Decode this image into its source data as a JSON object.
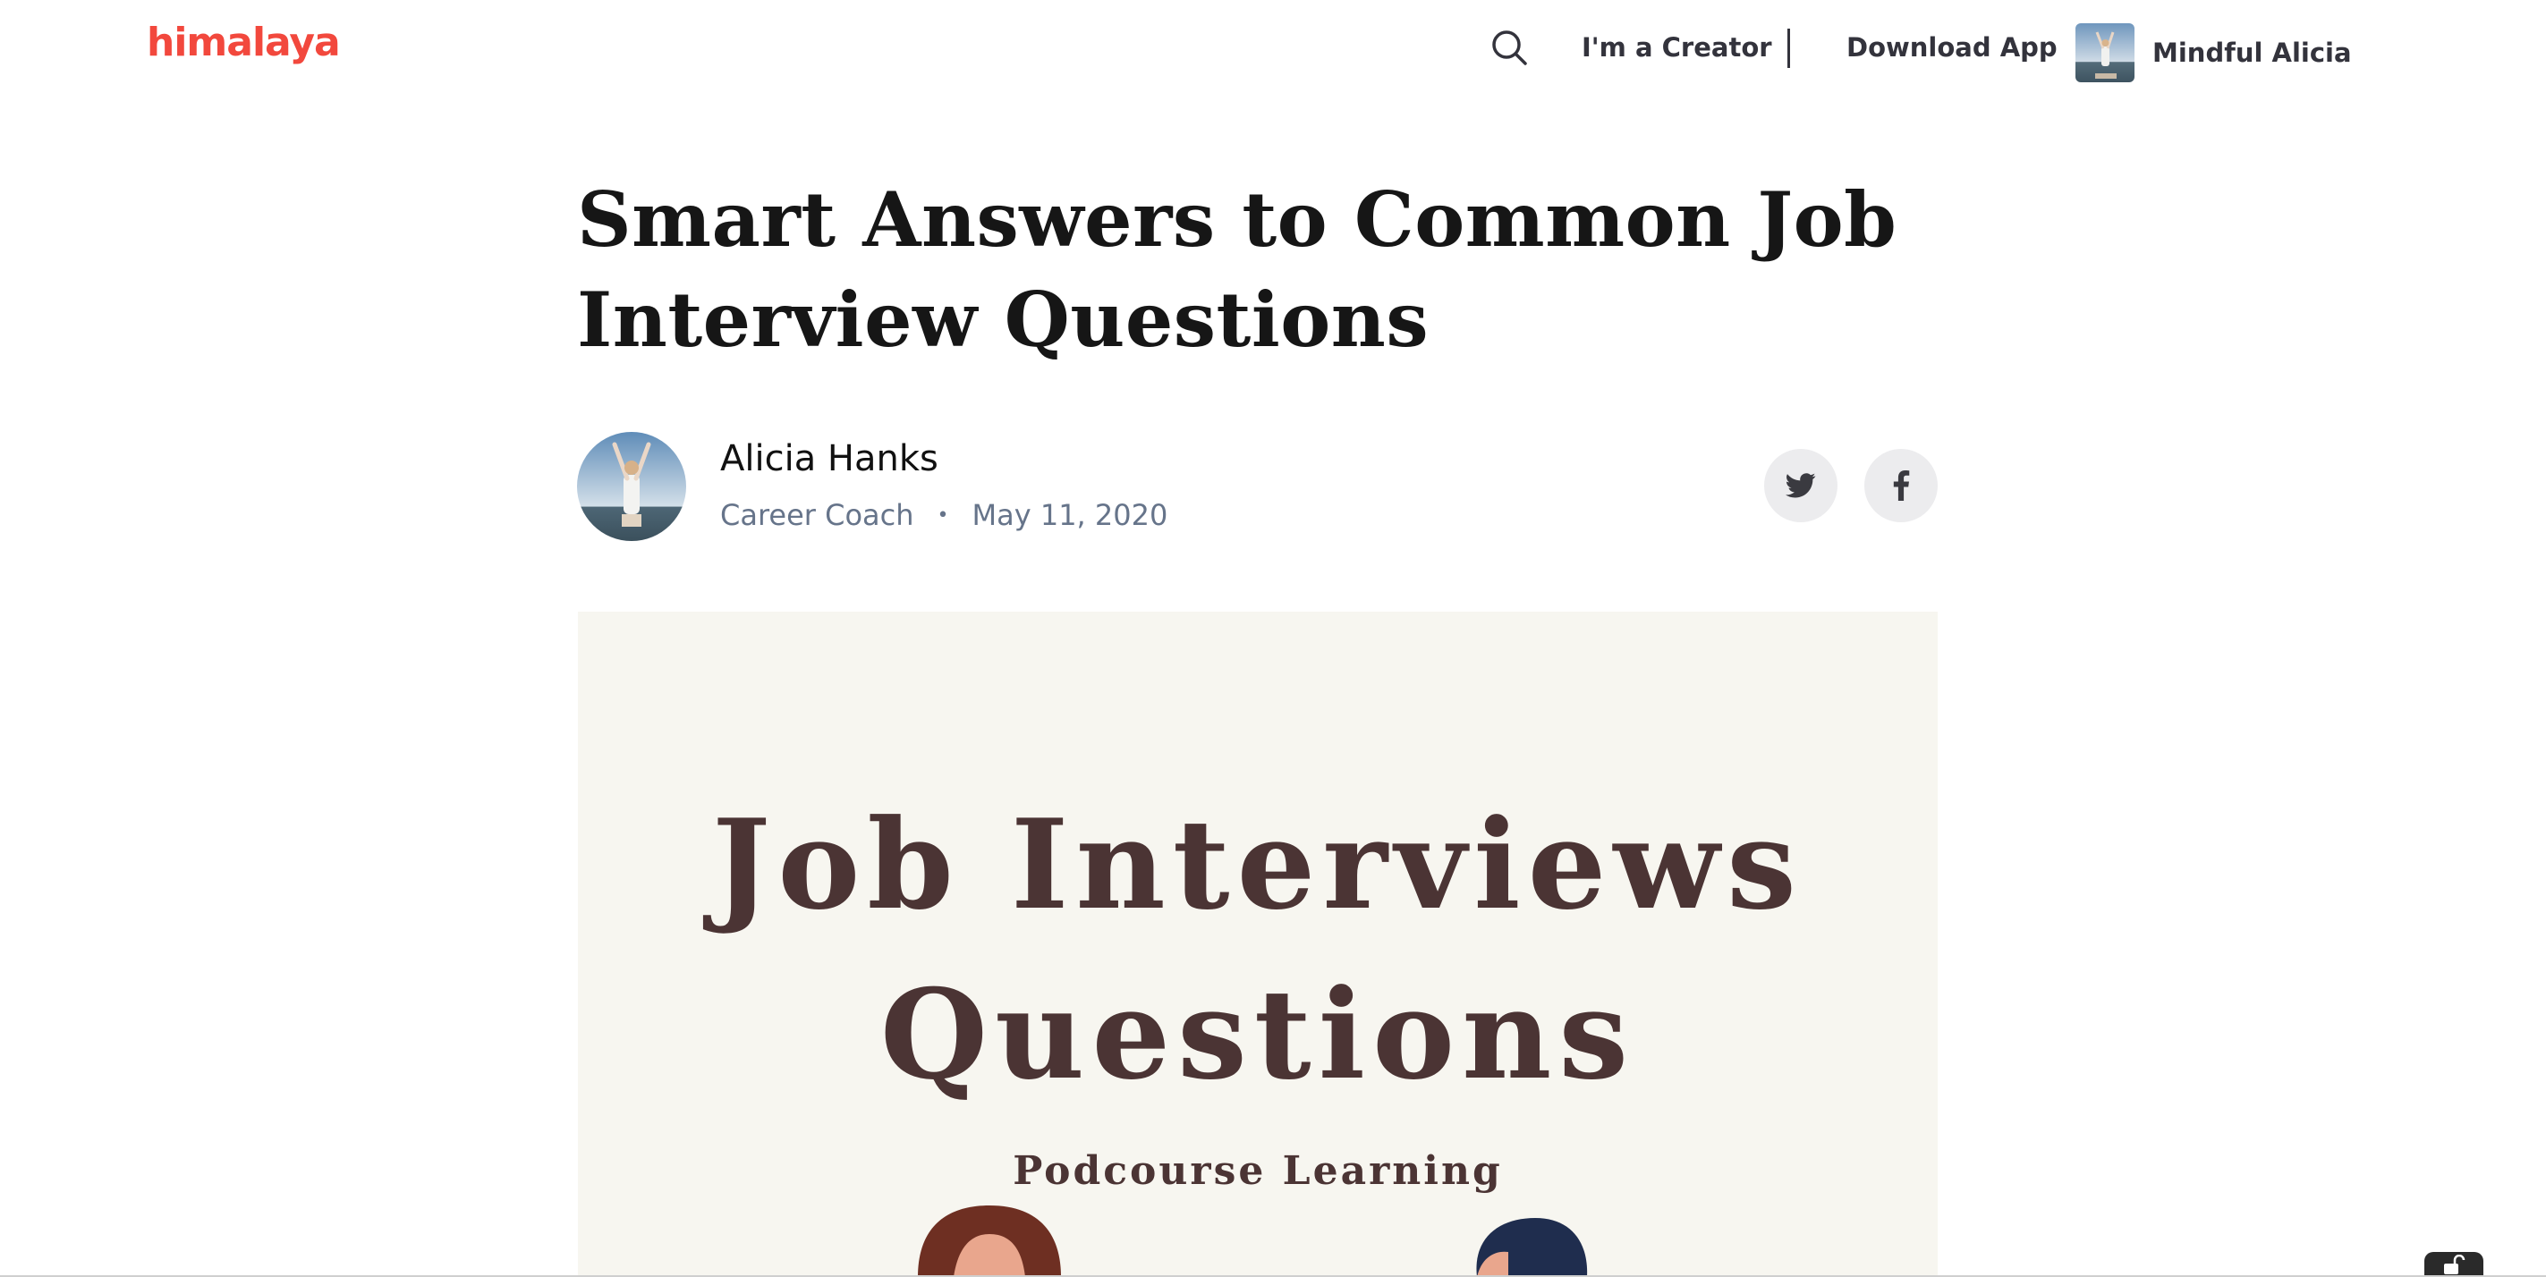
{
  "header": {
    "logo": "himalaya",
    "creator_link": "I'm a Creator",
    "separator": "|",
    "download_link": "Download App",
    "profile_name": "Mindful Alicia"
  },
  "article": {
    "title_line1": "Smart Answers to Common Job",
    "title_line2": "Interview Questions",
    "author": {
      "name": "Alicia Hanks",
      "role": "Career Coach",
      "date": "May 11, 2020"
    },
    "hero": {
      "title_line1": "Job Interviews",
      "title_line2": "Questions",
      "subtitle": "Podcourse Learning"
    }
  },
  "colors": {
    "brand": "#f2483d",
    "hero_bg": "#f7f6f0",
    "hero_text": "#4b3434",
    "meta_text": "#66748a"
  },
  "icons": [
    "search-icon",
    "twitter-icon",
    "facebook-icon",
    "lock-icon"
  ]
}
